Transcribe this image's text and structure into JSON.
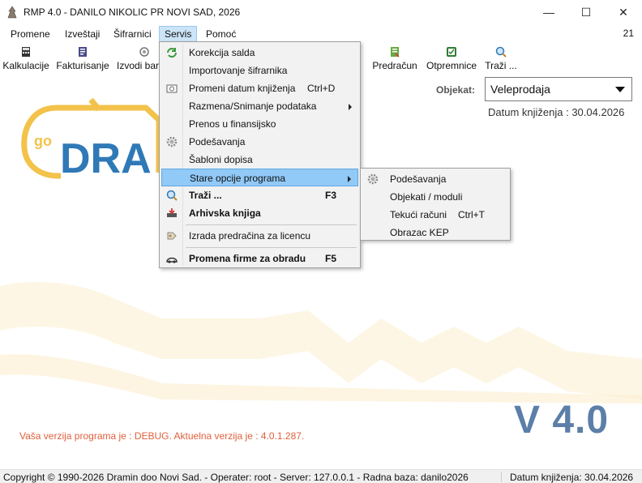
{
  "window": {
    "title": "RMP 4.0 - DANILO NIKOLIC PR NOVI SAD, 2026",
    "minimize_glyph": "—",
    "maximize_glyph": "☐",
    "close_glyph": "✕"
  },
  "menubar": {
    "items": [
      "Promene",
      "Izveštaji",
      "Šifrarnici",
      "Servis",
      "Pomoć"
    ],
    "active": "Servis",
    "right_text": "21"
  },
  "toolbar": {
    "items": [
      {
        "label": "Kalkulacije",
        "icon": "calculator-icon"
      },
      {
        "label": "Fakturisanje",
        "icon": "invoice-icon"
      },
      {
        "label": "Izvodi bar",
        "icon": "bank-statements-icon"
      },
      {
        "label": "Predračun",
        "icon": "proforma-icon"
      },
      {
        "label": "Otpremnice",
        "icon": "delivery-note-icon"
      },
      {
        "label": "Traži ...",
        "icon": "search-icon"
      }
    ]
  },
  "servis_menu": {
    "items": [
      {
        "label": "Korekcija salda",
        "shortcut": "",
        "icon": "refresh-icon"
      },
      {
        "label": "Importovanje šifrarnika",
        "shortcut": "",
        "icon": ""
      },
      {
        "label": "Promeni datum knjiženja",
        "shortcut": "Ctrl+D",
        "icon": "calendar-icon"
      },
      {
        "label": "Razmena/Snimanje podataka",
        "shortcut": "",
        "icon": ""
      },
      {
        "label": "Prenos u finansijsko",
        "shortcut": "",
        "icon": ""
      },
      {
        "label": "Podešavanja",
        "shortcut": "",
        "icon": "gear-icon"
      },
      {
        "label": "Šabloni dopisa",
        "shortcut": "",
        "icon": ""
      },
      {
        "label": "Stare opcije programa",
        "shortcut": "",
        "icon": ""
      },
      {
        "label": "Traži ...",
        "shortcut": "F3",
        "icon": "search-icon"
      },
      {
        "label": "Arhivska knjiga",
        "shortcut": "",
        "icon": "archive-icon"
      },
      {
        "label": "Izrada predračina za licencu",
        "shortcut": "",
        "icon": "license-icon"
      },
      {
        "label": "Promena firme za obradu",
        "shortcut": "F5",
        "icon": "company-switch-icon"
      }
    ]
  },
  "submenu": {
    "items": [
      {
        "label": "Podešavanja",
        "shortcut": "",
        "icon": "gear-icon"
      },
      {
        "label": "Objekati / moduli",
        "shortcut": ""
      },
      {
        "label": "Tekući računi",
        "shortcut": "Ctrl+T"
      },
      {
        "label": "Obrazac KEP",
        "shortcut": ""
      }
    ]
  },
  "content": {
    "objekat_label": "Objekat:",
    "objekat_value": "Veleprodaja",
    "datum_top": "Datum knjiženja : 30.04.2026",
    "version_message": "Vaša verzija programa je : DEBUG. Aktuelna verzija je : 4.0.1.287.",
    "version_big": "V 4.0",
    "logo_text_go": "go",
    "logo_text_dra": "DRA"
  },
  "statusbar": {
    "left": "Copyright © 1990-2026 Dramin doo Novi Sad. - Operater: root - Server: 127.0.0.1 - Radna baza: danilo2026",
    "right": "Datum knjiženja: 30.04.2026"
  },
  "colors": {
    "highlight": "#91c9f7",
    "menu_active": "#cce4f7",
    "version_text": "#5b7fa8",
    "warning_text": "#e0603c",
    "logo_gold": "#f2c24a",
    "logo_blue": "#2f79b7"
  }
}
